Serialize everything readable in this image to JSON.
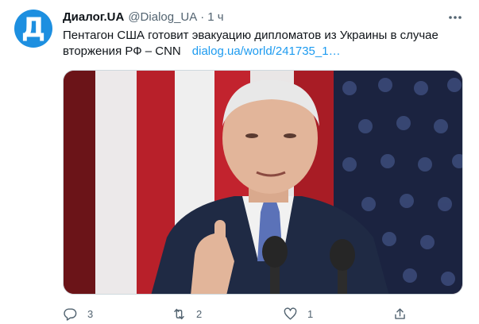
{
  "tweet": {
    "author_name": "Диалог.UA",
    "handle": "@Dialog_UA",
    "separator": "·",
    "time": "1 ч",
    "avatar_letter": "Д",
    "text": "Пентагон США готовит эвакуацию дипломатов из Украины в случае вторжения РФ – CNN",
    "link": "dialog.ua/world/241735_1…",
    "media_icon": "photo-of-speaker-at-podium-with-flag"
  },
  "actions": {
    "reply_count": "3",
    "retweet_count": "2",
    "like_count": "1",
    "icons": [
      "reply-icon",
      "retweet-icon",
      "like-icon",
      "share-icon"
    ]
  },
  "colors": {
    "brand_blue": "#1d9bf0",
    "avatar_blue": "#1d8fe0",
    "secondary_text": "#536471"
  }
}
